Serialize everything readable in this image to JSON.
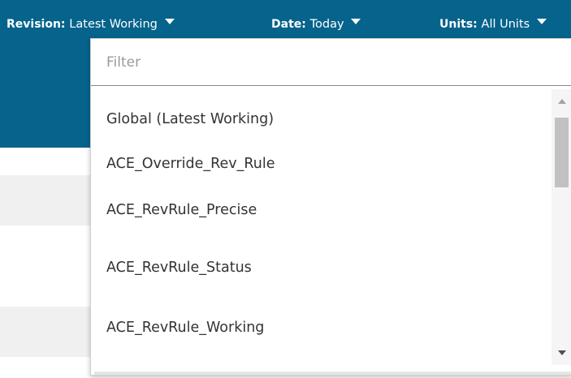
{
  "header": {
    "revision": {
      "label": "Revision:",
      "value": "Latest Working"
    },
    "date": {
      "label": "Date:",
      "value": "Today"
    },
    "units": {
      "label": "Units:",
      "value": "All Units"
    }
  },
  "dropdown": {
    "filter_placeholder": "Filter",
    "items": [
      "Global (Latest Working)",
      "ACE_Override_Rev_Rule",
      "ACE_RevRule_Precise",
      "ACE_RevRule_Status",
      "ACE_RevRule_Working"
    ]
  },
  "colors": {
    "header_bg": "#05638c",
    "header_text": "#ffffff",
    "list_text": "#333333"
  },
  "icons": [
    "dropdown-caret-icon",
    "scroll-up-arrow-icon",
    "scroll-down-arrow-icon"
  ]
}
